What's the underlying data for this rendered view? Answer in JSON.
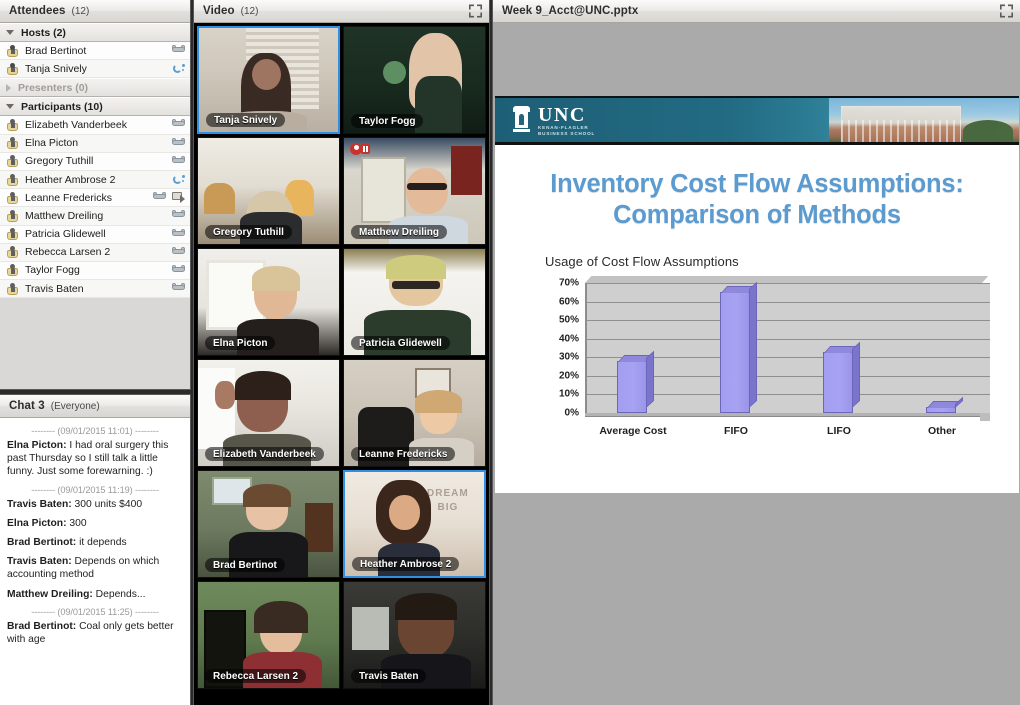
{
  "attendees": {
    "title": "Attendees",
    "count": "(12)",
    "maximize_icon": "maximize-icon",
    "groups": [
      {
        "label": "Hosts (2)",
        "state": "expanded",
        "disabled": false
      },
      {
        "label": "Presenters (0)",
        "state": "collapsed",
        "disabled": true
      },
      {
        "label": "Participants (10)",
        "state": "expanded",
        "disabled": false
      }
    ],
    "hosts": [
      {
        "name": "Brad Bertinot",
        "icons": [
          "phone-icon"
        ]
      },
      {
        "name": "Tanja Snively",
        "icons": [
          "phone-handset-active-icon"
        ]
      }
    ],
    "participants": [
      {
        "name": "Elizabeth Vanderbeek",
        "icons": [
          "phone-icon"
        ]
      },
      {
        "name": "Elna Picton",
        "icons": [
          "phone-icon"
        ]
      },
      {
        "name": "Gregory Tuthill",
        "icons": [
          "phone-icon"
        ]
      },
      {
        "name": "Heather Ambrose 2",
        "icons": [
          "phone-handset-active-icon"
        ]
      },
      {
        "name": "Leanne Fredericks",
        "icons": [
          "phone-icon",
          "screen-share-icon"
        ]
      },
      {
        "name": "Matthew Dreiling",
        "icons": [
          "phone-icon"
        ]
      },
      {
        "name": "Patricia Glidewell",
        "icons": [
          "phone-icon"
        ]
      },
      {
        "name": "Rebecca Larsen 2",
        "icons": [
          "phone-icon"
        ]
      },
      {
        "name": "Taylor Fogg",
        "icons": [
          "phone-icon"
        ]
      },
      {
        "name": "Travis Baten",
        "icons": [
          "phone-icon"
        ]
      }
    ]
  },
  "chat": {
    "title": "Chat 3",
    "scope": "(Everyone)",
    "messages": [
      {
        "type": "timestamp",
        "text": "-------- (09/01/2015 11:01) --------"
      },
      {
        "type": "message",
        "who": "Elna Picton:",
        "text": " I had oral surgery this past Thursday so I still talk a little funny. Just some forewarning. :)"
      },
      {
        "type": "timestamp",
        "text": "-------- (09/01/2015 11:19) --------"
      },
      {
        "type": "message",
        "who": "Travis Baten:",
        "text": " 300 units $400"
      },
      {
        "type": "message",
        "who": "Elna Picton:",
        "text": " 300"
      },
      {
        "type": "message",
        "who": "Brad Bertinot:",
        "text": " it depends"
      },
      {
        "type": "message",
        "who": "Travis Baten:",
        "text": " Depends on which accounting method"
      },
      {
        "type": "message",
        "who": "Matthew Dreiling:",
        "text": " Depends..."
      },
      {
        "type": "timestamp",
        "text": "-------- (09/01/2015 11:25) --------"
      },
      {
        "type": "message",
        "who": "Brad Bertinot:",
        "text": " Coal only gets better with age"
      }
    ]
  },
  "video": {
    "title": "Video",
    "count": "(12)",
    "maximize_icon": "maximize-icon",
    "tiles": [
      {
        "name": "Tanja Snively",
        "active": true,
        "muted": false,
        "bg": "indoor-blinds"
      },
      {
        "name": "Taylor Fogg",
        "active": false,
        "muted": false,
        "bg": "dark-green-room"
      },
      {
        "name": "Gregory Tuthill",
        "active": false,
        "muted": false,
        "bg": "living-room-lamp"
      },
      {
        "name": "Matthew Dreiling",
        "active": false,
        "muted": true,
        "bg": "french-doors"
      },
      {
        "name": "Elna Picton",
        "active": false,
        "muted": false,
        "bg": "white-fireplace"
      },
      {
        "name": "Patricia Glidewell",
        "active": false,
        "muted": false,
        "bg": "white-wall"
      },
      {
        "name": "Elizabeth Vanderbeek",
        "active": false,
        "muted": false,
        "bg": "bright-window"
      },
      {
        "name": "Leanne Fredericks",
        "active": false,
        "muted": false,
        "bg": "office-chair"
      },
      {
        "name": "Brad Bertinot",
        "active": false,
        "muted": false,
        "bg": "green-wall-shelf"
      },
      {
        "name": "Heather Ambrose 2",
        "active": true,
        "muted": false,
        "bg": "dream-big-poster"
      },
      {
        "name": "Rebecca Larsen 2",
        "active": false,
        "muted": false,
        "bg": "green-wall-bookcase"
      },
      {
        "name": "Travis Baten",
        "active": false,
        "muted": false,
        "bg": "dark-room-window"
      }
    ]
  },
  "share": {
    "title": "Week 9_Acct@UNC.pptx",
    "maximize_icon": "maximize-icon",
    "slide": {
      "logo": {
        "org": "UNC",
        "sub1": "KENAN-FLAGLER",
        "sub2": "BUSINESS SCHOOL"
      },
      "title_line1": "Inventory Cost Flow Assumptions:",
      "title_line2": "Comparison of Methods",
      "title_color": "#5b9bd0"
    }
  },
  "chart_data": {
    "type": "bar",
    "title": "Usage of Cost Flow Assumptions",
    "categories": [
      "Average Cost",
      "FIFO",
      "LIFO",
      "Other"
    ],
    "values": [
      28,
      65,
      33,
      3
    ],
    "xlabel": "",
    "ylabel": "",
    "ylim": [
      0,
      70
    ],
    "yticks": [
      0,
      10,
      20,
      30,
      40,
      50,
      60,
      70
    ],
    "ytick_labels": [
      "0%",
      "10%",
      "20%",
      "30%",
      "40%",
      "50%",
      "60%",
      "70%"
    ],
    "grid": true,
    "legend": false,
    "bar_color": "#a39ef0",
    "plot_bg": "#cfcfcf"
  }
}
